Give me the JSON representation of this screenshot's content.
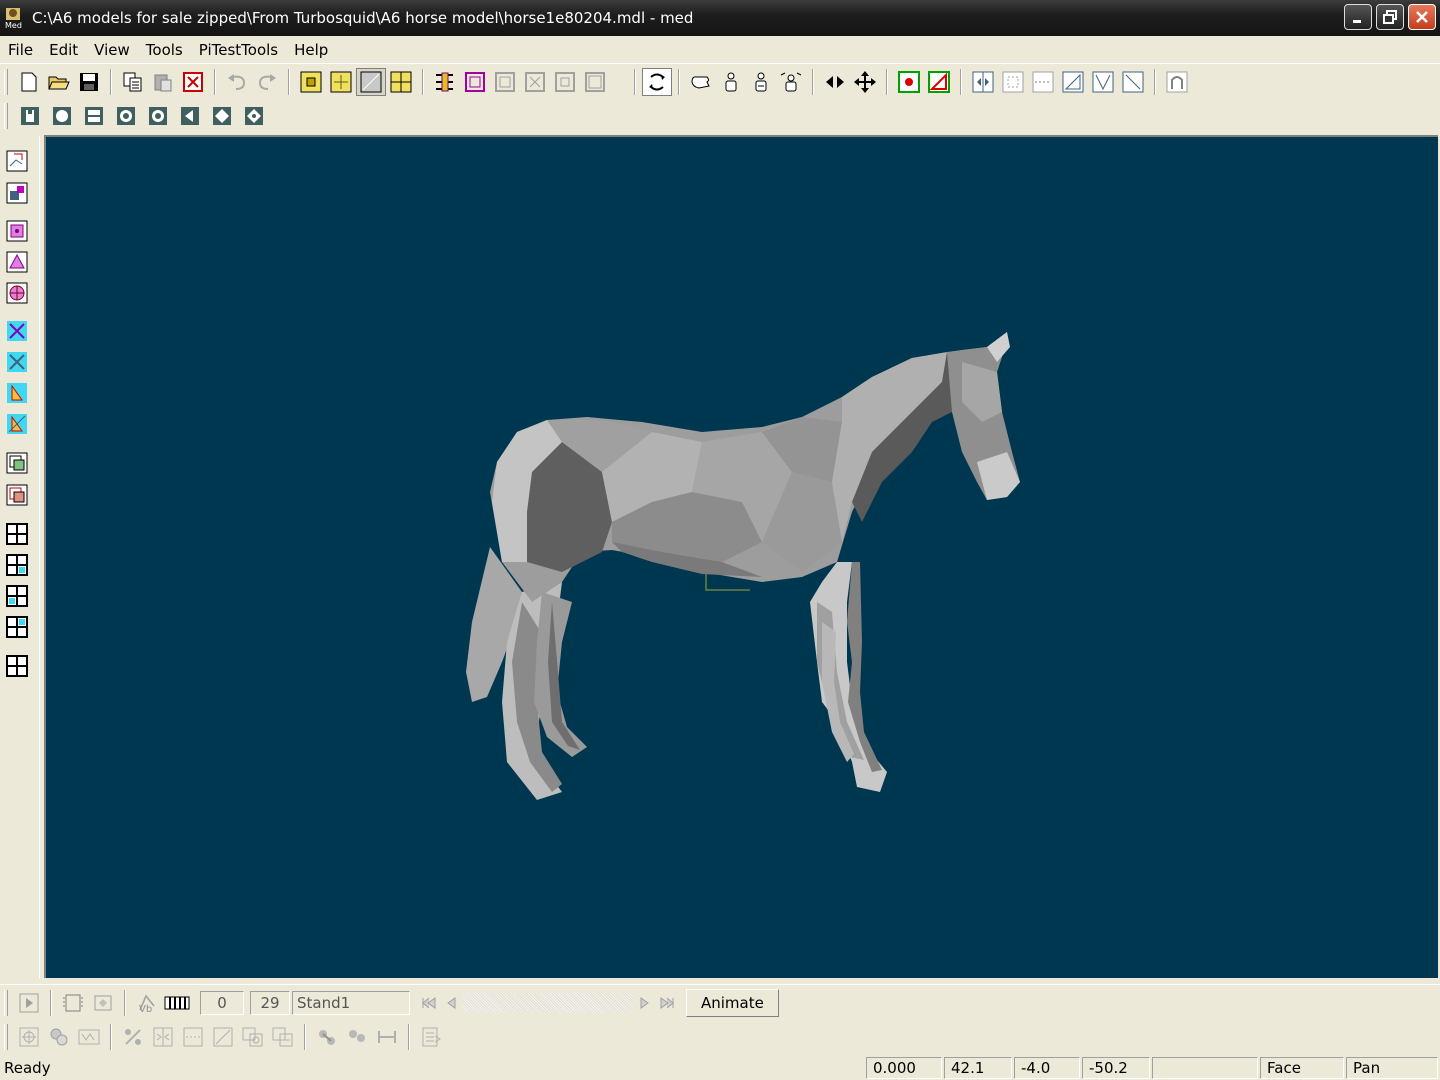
{
  "window": {
    "title": "C:\\A6 models for sale zipped\\From Turbosquid\\A6 horse model\\horse1e80204.mdl - med",
    "app_icon": "med-app-icon",
    "controls": [
      "minimize-icon",
      "restore-icon",
      "close-icon"
    ]
  },
  "menu": [
    "File",
    "Edit",
    "View",
    "Tools",
    "PiTestTools",
    "Help"
  ],
  "toolbar_main": [
    "new-file-icon",
    "open-folder-icon",
    "save-icon",
    "copy-icon",
    "paste-icon",
    "delete-icon",
    "undo-icon",
    "redo-icon",
    "select-vertex-icon",
    "move-vertex-icon",
    "select-box-icon",
    "select-face-icon",
    "bone-icon",
    "frame-magenta-icon",
    "frame-grey-1-icon",
    "frame-grey-2-icon",
    "frame-grey-3-icon",
    "frame-grey-4-icon",
    "rotate-view-icon",
    "hand-pan-icon",
    "scale-person-icon",
    "scale-person-2-icon",
    "scale-all-icon",
    "flip-icon",
    "move-icon",
    "add-vertex-icon",
    "add-triangle-icon",
    "mirror-icon",
    "grid-dots-icon",
    "dashed-line-icon",
    "skin-map-icon",
    "uv-map-icon",
    "cross-map-icon",
    "magnet-icon"
  ],
  "toolbar_views": [
    "view-top-icon",
    "view-front-icon",
    "view-side-icon",
    "view-back-icon",
    "view-bottom-icon",
    "view-left-icon",
    "view-right-icon",
    "view-3d-icon"
  ],
  "toolbar_left": [
    "select-move-icon",
    "select-scale-icon",
    "vertex-mode-icon",
    "triangle-mode-icon",
    "object-mode-icon",
    "axis-x-icon",
    "axis-y-icon",
    "axis-z-icon",
    "axis-all-icon",
    "zoom-in-icon",
    "zoom-out-icon",
    "layout-1-icon",
    "layout-2-icon",
    "layout-3-icon",
    "layout-4-icon",
    "layout-single-icon"
  ],
  "colors": {
    "viewport_bg": "#003750",
    "model_light": "#a8a8a8",
    "model_dark": "#5f5f5f"
  },
  "anim": {
    "frame_start": "0",
    "frame_end": "29",
    "scene_name": "Stand1",
    "animate_label": "Animate",
    "icons": [
      "play-icon",
      "frames-icon",
      "frames-disabled-icon",
      "vertex-anim-icon",
      "film-strip-icon",
      "first-frame-icon",
      "prev-frame-icon",
      "next-frame-icon",
      "last-frame-icon"
    ]
  },
  "edit_tools": [
    "add-icon",
    "weld-icon",
    "merge-icon",
    "percent-icon",
    "mirror-vert-icon",
    "dotted-icon",
    "cut-icon",
    "duplicate-icon",
    "extrude-icon",
    "link-icon",
    "unlink-icon",
    "measure-icon",
    "properties-icon"
  ],
  "status": {
    "text": "Ready",
    "value1": "0.000",
    "value2": "42.1",
    "value3": "-4.0",
    "value4": "-50.2",
    "mode": "Face",
    "action": "Pan"
  }
}
